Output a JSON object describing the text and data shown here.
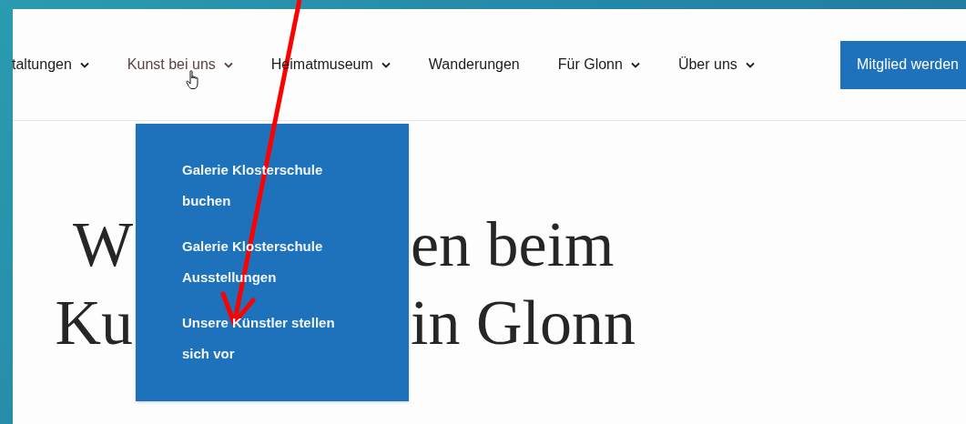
{
  "nav": {
    "items": [
      {
        "label": "taltungen",
        "has_submenu": true,
        "selected": false
      },
      {
        "label": "Kunst bei uns",
        "has_submenu": true,
        "selected": true
      },
      {
        "label": "Heimatmuseum",
        "has_submenu": true,
        "selected": false
      },
      {
        "label": "Wanderungen",
        "has_submenu": false,
        "selected": false
      },
      {
        "label": "Für Glonn",
        "has_submenu": true,
        "selected": false
      },
      {
        "label": "Über uns",
        "has_submenu": true,
        "selected": false
      }
    ],
    "button": "Mitglied werden"
  },
  "dropdown": {
    "items": [
      "Galerie Klosterschule buchen",
      "Galerie Klosterschule Ausstellungen",
      "Unsere Künstler stellen sich vor"
    ]
  },
  "heading": {
    "lines": [
      {
        "left": "W",
        "right": "en beim"
      },
      {
        "left": "Ku",
        "right": "in Glonn"
      }
    ]
  }
}
